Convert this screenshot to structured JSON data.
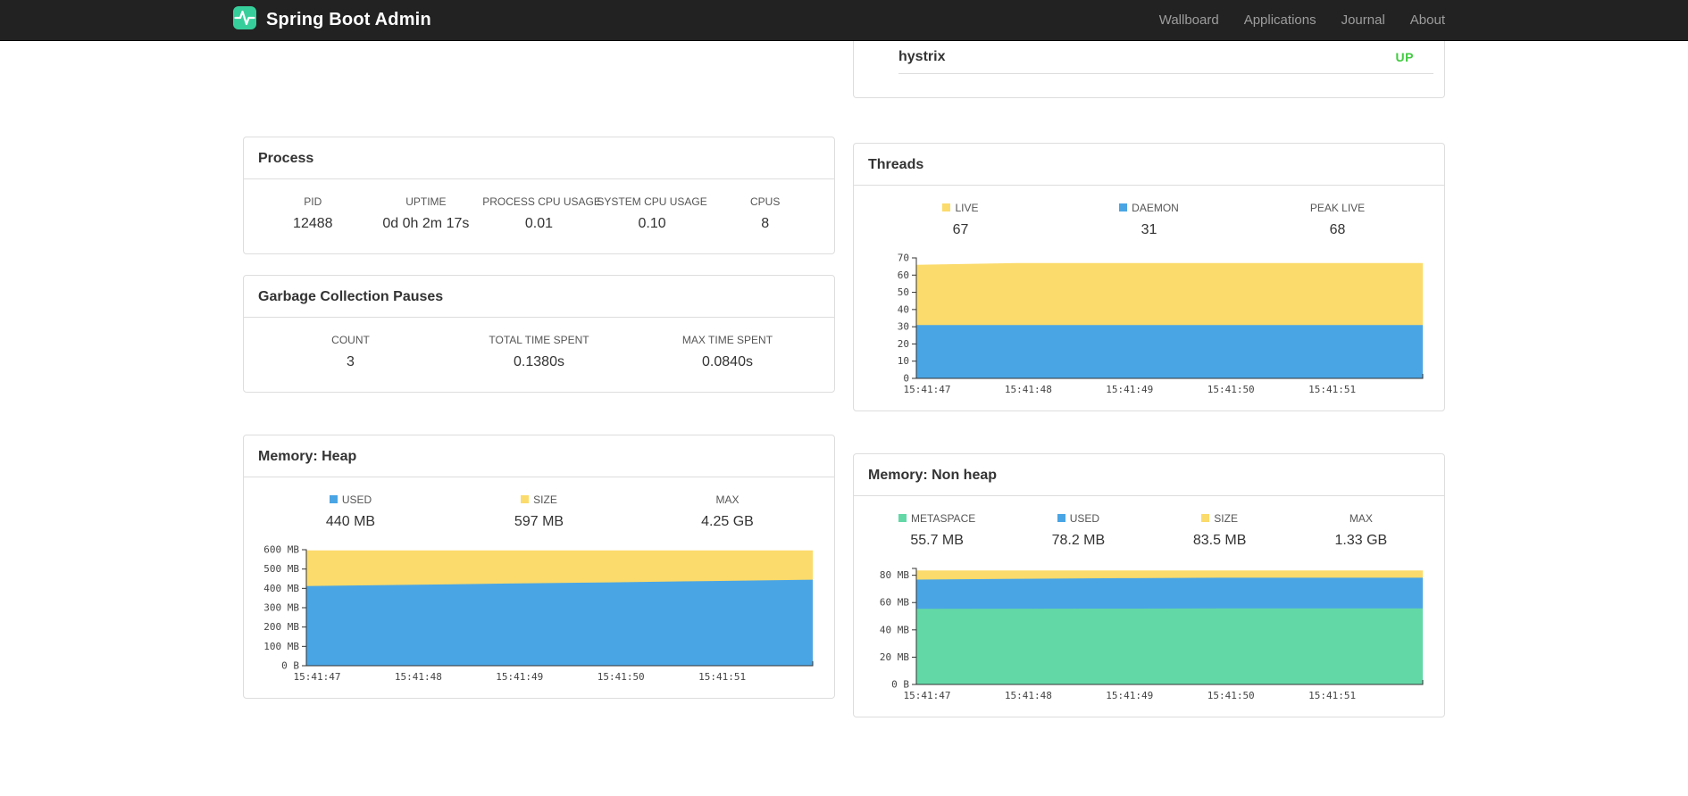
{
  "navbar": {
    "brand": "Spring Boot Admin",
    "links": [
      "Wallboard",
      "Applications",
      "Journal",
      "About"
    ]
  },
  "colors": {
    "yellow": "#fbdb6b",
    "blue": "#4aa5e4",
    "green": "#63d8a7",
    "status_up": "#41cc41",
    "brand_icon": "#36cf9b"
  },
  "health": {
    "service": "hystrix",
    "status": "UP"
  },
  "panels": {
    "process": {
      "title": "Process",
      "stats": [
        {
          "label": "PID",
          "value": "12488"
        },
        {
          "label": "UPTIME",
          "value": "0d 0h 2m 17s"
        },
        {
          "label": "PROCESS CPU USAGE",
          "value": "0.01"
        },
        {
          "label": "SYSTEM CPU USAGE",
          "value": "0.10"
        },
        {
          "label": "CPUS",
          "value": "8"
        }
      ]
    },
    "gc": {
      "title": "Garbage Collection Pauses",
      "stats": [
        {
          "label": "COUNT",
          "value": "3"
        },
        {
          "label": "TOTAL TIME SPENT",
          "value": "0.1380s"
        },
        {
          "label": "MAX TIME SPENT",
          "value": "0.0840s"
        }
      ]
    },
    "threads": {
      "title": "Threads",
      "stats": [
        {
          "label": "LIVE",
          "value": "67",
          "swatch": "#fbdb6b"
        },
        {
          "label": "DAEMON",
          "value": "31",
          "swatch": "#4aa5e4"
        },
        {
          "label": "PEAK LIVE",
          "value": "68"
        }
      ]
    },
    "heap": {
      "title": "Memory: Heap",
      "stats": [
        {
          "label": "USED",
          "value": "440 MB",
          "swatch": "#4aa5e4"
        },
        {
          "label": "SIZE",
          "value": "597 MB",
          "swatch": "#fbdb6b"
        },
        {
          "label": "MAX",
          "value": "4.25 GB"
        }
      ]
    },
    "nonheap": {
      "title": "Memory: Non heap",
      "stats": [
        {
          "label": "METASPACE",
          "value": "55.7 MB",
          "swatch": "#63d8a7"
        },
        {
          "label": "USED",
          "value": "78.2 MB",
          "swatch": "#4aa5e4"
        },
        {
          "label": "SIZE",
          "value": "83.5 MB",
          "swatch": "#fbdb6b"
        },
        {
          "label": "MAX",
          "value": "1.33 GB"
        }
      ]
    }
  },
  "chart_data": [
    {
      "name": "threads",
      "type": "area",
      "title": "Threads",
      "x_labels": [
        "15:41:47",
        "15:41:48",
        "15:41:49",
        "15:41:50",
        "15:41:51"
      ],
      "y_max": 70,
      "height": 165,
      "y_ticks": [
        {
          "v": 0,
          "label": "0"
        },
        {
          "v": 10,
          "label": "10"
        },
        {
          "v": 20,
          "label": "20"
        },
        {
          "v": 30,
          "label": "30"
        },
        {
          "v": 40,
          "label": "40"
        },
        {
          "v": 50,
          "label": "50"
        },
        {
          "v": 60,
          "label": "60"
        },
        {
          "v": 70,
          "label": "70"
        }
      ],
      "series": [
        {
          "name": "LIVE",
          "color": "#fbdb6b",
          "values": [
            66,
            67,
            67,
            67,
            67,
            67
          ]
        },
        {
          "name": "DAEMON",
          "color": "#4aa5e4",
          "values": [
            31,
            31,
            31,
            31,
            31,
            31
          ]
        }
      ]
    },
    {
      "name": "memory-heap",
      "type": "area",
      "title": "Memory: Heap",
      "x_labels": [
        "15:41:47",
        "15:41:48",
        "15:41:49",
        "15:41:50",
        "15:41:51"
      ],
      "y_max": 600,
      "height": 160,
      "y_ticks": [
        {
          "v": 0,
          "label": "0 B"
        },
        {
          "v": 100,
          "label": "100 MB"
        },
        {
          "v": 200,
          "label": "200 MB"
        },
        {
          "v": 300,
          "label": "300 MB"
        },
        {
          "v": 400,
          "label": "400 MB"
        },
        {
          "v": 500,
          "label": "500 MB"
        },
        {
          "v": 600,
          "label": "600 MB"
        }
      ],
      "series": [
        {
          "name": "SIZE",
          "color": "#fbdb6b",
          "values": [
            597,
            597,
            597,
            597,
            597,
            597
          ]
        },
        {
          "name": "USED",
          "color": "#4aa5e4",
          "values": [
            412,
            418,
            425,
            431,
            438,
            445
          ]
        }
      ]
    },
    {
      "name": "memory-nonheap",
      "type": "area",
      "title": "Memory: Non heap",
      "x_labels": [
        "15:41:47",
        "15:41:48",
        "15:41:49",
        "15:41:50",
        "15:41:51"
      ],
      "y_max": 85,
      "height": 160,
      "y_ticks": [
        {
          "v": 0,
          "label": "0 B"
        },
        {
          "v": 20,
          "label": "20 MB"
        },
        {
          "v": 40,
          "label": "40 MB"
        },
        {
          "v": 60,
          "label": "60 MB"
        },
        {
          "v": 80,
          "label": "80 MB"
        }
      ],
      "series": [
        {
          "name": "SIZE",
          "color": "#fbdb6b",
          "values": [
            83.5,
            83.5,
            83.5,
            83.5,
            83.5,
            83.5
          ]
        },
        {
          "name": "USED",
          "color": "#4aa5e4",
          "values": [
            76.8,
            77.4,
            77.9,
            78.2,
            78.2,
            78.2
          ]
        },
        {
          "name": "METASPACE",
          "color": "#63d8a7",
          "values": [
            55.4,
            55.5,
            55.6,
            55.7,
            55.7,
            55.7
          ]
        }
      ]
    }
  ]
}
